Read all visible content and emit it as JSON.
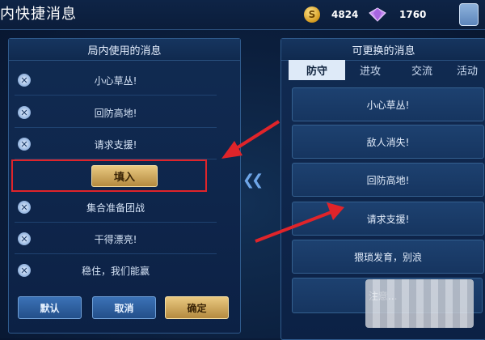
{
  "header": {
    "title": "内快捷消息",
    "gold": "4824",
    "diamond": "1760"
  },
  "left_panel": {
    "title": "局内使用的消息",
    "rows": [
      "小心草丛!",
      "回防高地!",
      "请求支援!",
      "",
      "集合准备团战",
      "干得漂亮!",
      "稳住，我们能赢"
    ],
    "fill_label": "填入",
    "buttons": {
      "default": "默认",
      "cancel": "取消",
      "confirm": "确定"
    }
  },
  "right_panel": {
    "title": "可更换的消息",
    "tabs": [
      "防守",
      "进攻",
      "交流",
      "活动"
    ],
    "active_tab": 0,
    "items": [
      "小心草丛!",
      "敌人消失!",
      "回防高地!",
      "请求支援!",
      "猥琐发育，别浪",
      "注意..."
    ]
  },
  "colors": {
    "accent_red": "#e0242a",
    "gold": "#d9b064"
  }
}
